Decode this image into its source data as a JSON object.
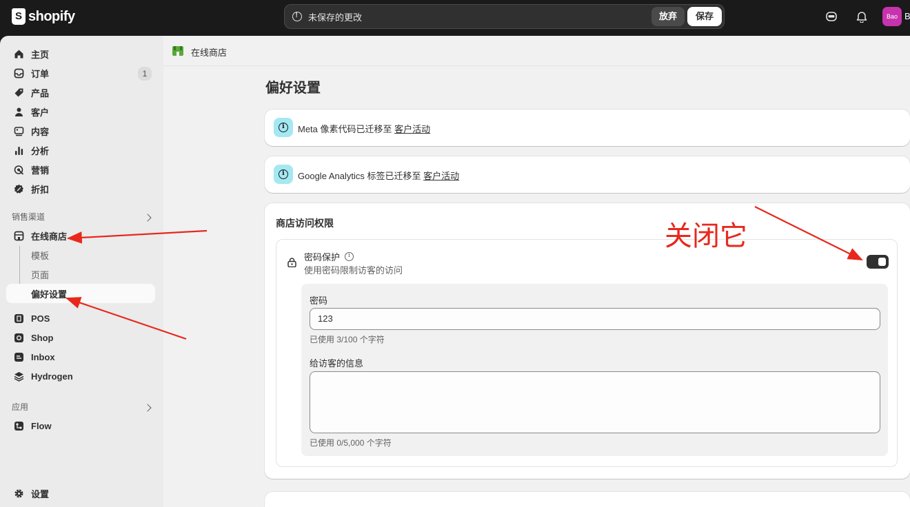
{
  "topbar": {
    "logo_text": "shopify",
    "savebar_text": "未保存的更改",
    "discard_label": "放弃",
    "save_label": "保存",
    "avatar_text": "Bao",
    "avatar_letter": "B"
  },
  "sidebar": {
    "items": [
      {
        "label": "主页",
        "icon": "home-icon"
      },
      {
        "label": "订单",
        "icon": "orders-icon",
        "badge": "1"
      },
      {
        "label": "产品",
        "icon": "tag-icon"
      },
      {
        "label": "客户",
        "icon": "person-icon"
      },
      {
        "label": "内容",
        "icon": "content-icon"
      },
      {
        "label": "分析",
        "icon": "bar-chart-icon"
      },
      {
        "label": "营销",
        "icon": "target-icon"
      },
      {
        "label": "折扣",
        "icon": "discount-icon"
      }
    ],
    "channels_label": "销售渠道",
    "online_store": "在线商店",
    "sub_items": [
      "模板",
      "页面",
      "偏好设置"
    ],
    "channels": [
      {
        "label": "POS",
        "icon": "pos-icon"
      },
      {
        "label": "Shop",
        "icon": "shop-icon"
      },
      {
        "label": "Inbox",
        "icon": "inbox-icon"
      },
      {
        "label": "Hydrogen",
        "icon": "hydrogen-icon"
      }
    ],
    "apps_label": "应用",
    "apps": [
      {
        "label": "Flow",
        "icon": "flow-icon"
      }
    ],
    "settings": "设置"
  },
  "main": {
    "breadcrumb": "在线商店",
    "page_title": "偏好设置",
    "banner_meta": {
      "text": "Meta 像素代码已迁移至 ",
      "link": "客户活动"
    },
    "banner_ga": {
      "text": "Google Analytics 标签已迁移至 ",
      "link": "客户活动"
    },
    "access": {
      "title": "商店访问权限",
      "pw_title": "密码保护",
      "pw_sub": "使用密码限制访客的访问",
      "toggle_on": true,
      "password_label": "密码",
      "password_value": "123",
      "password_help": "已使用 3/100 个字符",
      "message_label": "给访客的信息",
      "message_value": "",
      "message_help": "已使用 0/5,000 个字符"
    }
  },
  "annotation": {
    "text": "关闭它",
    "color": "#e8281c"
  }
}
